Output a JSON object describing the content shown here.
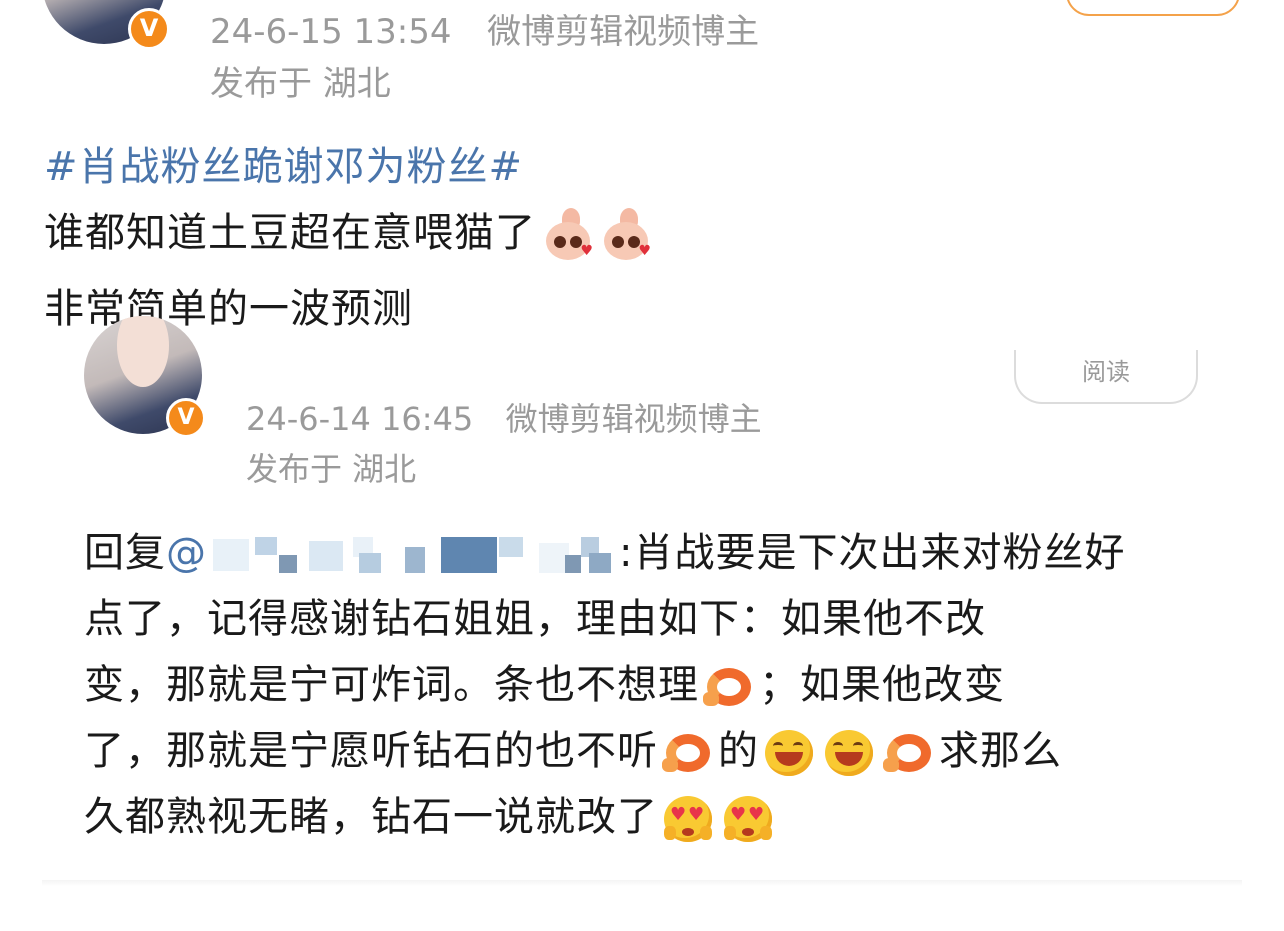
{
  "post": {
    "timestamp": "24-6-15 13:54",
    "source": "微博剪辑视频博主",
    "location": "发布于 湖北",
    "hashtag": "#肖战粉丝跪谢邓为粉丝#",
    "lines": [
      "谁都知道土豆超在意喂猫了",
      "非常简单的一波预测"
    ],
    "line1_emojis": [
      "bunny-sticker",
      "bunny-sticker"
    ]
  },
  "quote": {
    "timestamp": "24-6-14 16:45",
    "source": "微博剪辑视频博主",
    "location": "发布于 湖北",
    "read_label": "阅读",
    "reply_prefix": "回复",
    "mention_at": "@",
    "reply_lines": {
      "l1_tail": ":肖战要是下次出来对粉丝好",
      "l2": "点了，记得感谢钻石姐姐，理由如下：如果他不改",
      "l3_a": "变，那就是宁可炸词。条也不想理",
      "l3_b": "；如果他改变",
      "l4_a": "了，那就是宁愿听钻石的也不听",
      "l4_b": "的",
      "l4_c": "求那么",
      "l5": "久都熟视无睹，钻石一说就改了"
    }
  },
  "colors": {
    "link_blue": "#4a75ab",
    "badge_orange": "#f48a1b",
    "meta_gray": "#9a9a9a",
    "text": "#1a1a1a"
  },
  "icons": {
    "verified": "verified-badge-icon",
    "shrimp": "shrimp-emoji-icon",
    "laugh": "laughing-emoji-icon",
    "love": "heart-eyes-emoji-icon",
    "bunny": "bunny-sticker-icon"
  }
}
